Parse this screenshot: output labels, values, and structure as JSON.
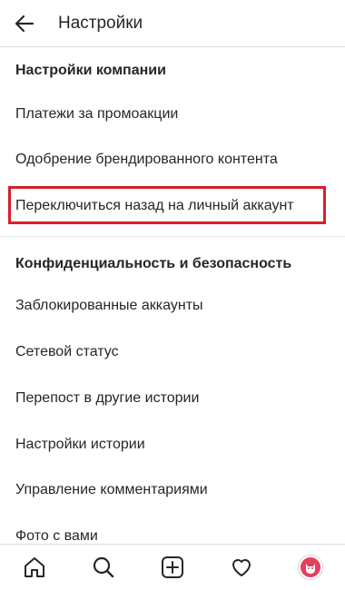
{
  "header": {
    "title": "Настройки",
    "back_icon": "arrow-left-icon"
  },
  "sections": {
    "company": {
      "title": "Настройки компании",
      "items": [
        "Платежи за промоакции",
        "Одобрение брендированного контента",
        "Переключиться назад на личный аккаунт"
      ]
    },
    "privacy": {
      "title": "Конфиденциальность и безопасность",
      "items": [
        "Заблокированные аккаунты",
        "Сетевой статус",
        "Перепост в другие истории",
        "Настройки истории",
        "Управление комментариями",
        "Фото с вами"
      ]
    }
  },
  "highlight_color": "#d91e2b",
  "bottom_nav": [
    "home-icon",
    "search-icon",
    "add-post-icon",
    "heart-icon",
    "profile-avatar"
  ]
}
